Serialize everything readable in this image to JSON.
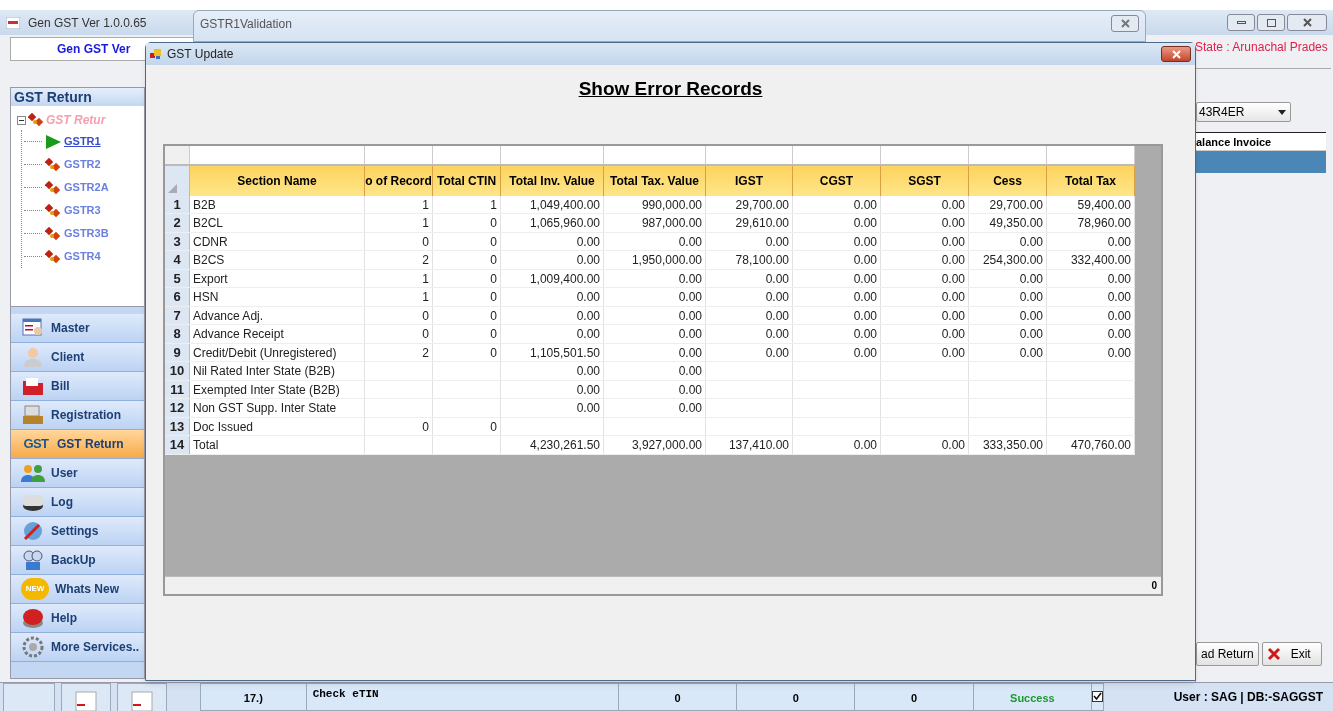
{
  "app_window": {
    "title": "Gen GST  Ver 1.0.0.65",
    "banner": "Gen GST  Ver",
    "state_label": "State : Arunachal Prades",
    "sidebar": {
      "title": "GST Return",
      "tree": [
        {
          "label": "GST Retur",
          "expanded": true,
          "children": [
            {
              "label": "GSTR1",
              "selected": true
            },
            {
              "label": "GSTR2",
              "selected": false
            },
            {
              "label": "GSTR2A",
              "selected": false
            },
            {
              "label": "GSTR3",
              "selected": false
            },
            {
              "label": "GSTR3B",
              "selected": false
            },
            {
              "label": "GSTR4",
              "selected": false
            }
          ]
        }
      ]
    },
    "nav": [
      {
        "label": "Master",
        "selected": false
      },
      {
        "label": "Client",
        "selected": false
      },
      {
        "label": "Bill",
        "selected": false
      },
      {
        "label": "Registration",
        "selected": false
      },
      {
        "label": "GST Return",
        "selected": true,
        "badge": "GST"
      },
      {
        "label": "User",
        "selected": false
      },
      {
        "label": "Log",
        "selected": false
      },
      {
        "label": "Settings",
        "selected": false
      },
      {
        "label": "BackUp",
        "selected": false
      },
      {
        "label": "Whats New",
        "selected": false,
        "badge": "NEW"
      },
      {
        "label": "Help",
        "selected": false
      },
      {
        "label": "More Services..",
        "selected": false
      }
    ],
    "gstin_combo": "43R4ER",
    "grid_header": "alance Invoice",
    "buttons": [
      {
        "label": "ad Return",
        "kind": "plain"
      },
      {
        "label": "Exit",
        "kind": "exit"
      }
    ],
    "status_user": "User : SAG | DB:-SAGGST"
  },
  "validation_window": {
    "title": "GSTR1Validation",
    "row": {
      "number": "17.)",
      "name": "Check eTIN",
      "cells": [
        "0",
        "0",
        "0"
      ],
      "status": "Success",
      "checked": true
    }
  },
  "dialog": {
    "title": "GST Update",
    "heading": "Show Error Records",
    "table": {
      "columns": [
        "Section Name",
        "o of Record",
        "Total CTIN",
        "Total Inv. Value",
        "Total Tax. Value",
        "IGST",
        "CGST",
        "SGST",
        "Cess",
        "Total Tax"
      ],
      "rows": [
        {
          "number": "1",
          "cells": [
            "B2B",
            "1",
            "1",
            "1,049,400.00",
            "990,000.00",
            "29,700.00",
            "0.00",
            "0.00",
            "29,700.00",
            "59,400.00"
          ]
        },
        {
          "number": "2",
          "cells": [
            "B2CL",
            "1",
            "0",
            "1,065,960.00",
            "987,000.00",
            "29,610.00",
            "0.00",
            "0.00",
            "49,350.00",
            "78,960.00"
          ]
        },
        {
          "number": "3",
          "cells": [
            "CDNR",
            "0",
            "0",
            "0.00",
            "0.00",
            "0.00",
            "0.00",
            "0.00",
            "0.00",
            "0.00"
          ]
        },
        {
          "number": "4",
          "cells": [
            "B2CS",
            "2",
            "0",
            "0.00",
            "1,950,000.00",
            "78,100.00",
            "0.00",
            "0.00",
            "254,300.00",
            "332,400.00"
          ]
        },
        {
          "number": "5",
          "cells": [
            "Export",
            "1",
            "0",
            "1,009,400.00",
            "0.00",
            "0.00",
            "0.00",
            "0.00",
            "0.00",
            "0.00"
          ]
        },
        {
          "number": "6",
          "cells": [
            "HSN",
            "1",
            "0",
            "0.00",
            "0.00",
            "0.00",
            "0.00",
            "0.00",
            "0.00",
            "0.00"
          ]
        },
        {
          "number": "7",
          "cells": [
            "Advance Adj.",
            "0",
            "0",
            "0.00",
            "0.00",
            "0.00",
            "0.00",
            "0.00",
            "0.00",
            "0.00"
          ]
        },
        {
          "number": "8",
          "cells": [
            "Advance Receipt",
            "0",
            "0",
            "0.00",
            "0.00",
            "0.00",
            "0.00",
            "0.00",
            "0.00",
            "0.00"
          ]
        },
        {
          "number": "9",
          "cells": [
            "Credit/Debit (Unregistered)",
            "2",
            "0",
            "1,105,501.50",
            "0.00",
            "0.00",
            "0.00",
            "0.00",
            "0.00",
            "0.00"
          ]
        },
        {
          "number": "10",
          "cells": [
            "Nil Rated Inter State (B2B)",
            null,
            null,
            "0.00",
            "0.00",
            null,
            null,
            null,
            null,
            null
          ]
        },
        {
          "number": "11",
          "cells": [
            "Exempted Inter State (B2B)",
            null,
            null,
            "0.00",
            "0.00",
            null,
            null,
            null,
            null,
            null
          ]
        },
        {
          "number": "12",
          "cells": [
            "Non GST Supp. Inter State",
            null,
            null,
            "0.00",
            "0.00",
            null,
            null,
            null,
            null,
            null
          ]
        },
        {
          "number": "13",
          "cells": [
            "Doc Issued",
            "0",
            "0",
            null,
            null,
            null,
            null,
            null,
            null,
            null
          ]
        },
        {
          "number": "14",
          "cells": [
            "Total",
            null,
            null,
            "4,230,261.50",
            "3,927,000.00",
            "137,410.00",
            "0.00",
            "0.00",
            "333,350.00",
            "470,760.00"
          ]
        }
      ]
    },
    "footer_count": "0"
  }
}
